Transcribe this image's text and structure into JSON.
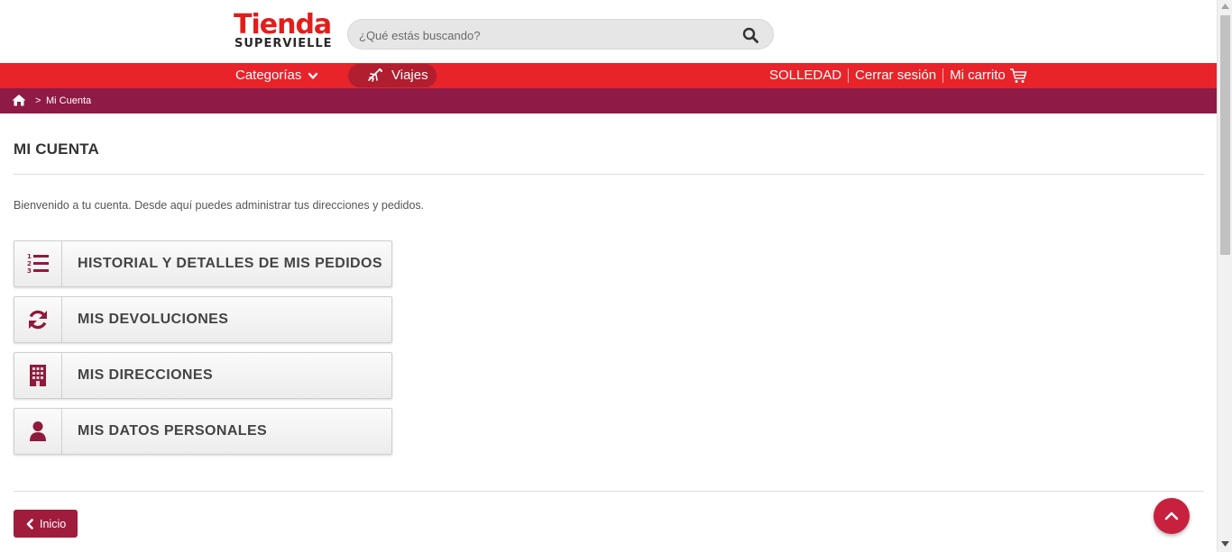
{
  "brand": {
    "name": "Tienda",
    "sub": "SUPERVIELLE",
    "color": "#e31d1a"
  },
  "search": {
    "placeholder": "¿Qué estás buscando?",
    "value": "",
    "icon": "search-icon"
  },
  "nav": {
    "categories_label": "Categorías",
    "viajes_label": "Viajes",
    "user_label": "SOLLEDAD",
    "logout_label": "Cerrar sesión",
    "cart_label": "Mi carrito",
    "bar_color": "#e8232a"
  },
  "breadcrumb": {
    "separator": ">",
    "current": "Mi Cuenta",
    "bar_color": "#8e1a45"
  },
  "main": {
    "title": "MI CUENTA",
    "welcome": "Bienvenido a tu cuenta. Desde aquí puedes administrar tus direcciones y pedidos.",
    "options": [
      {
        "label": "HISTORIAL Y DETALLES DE MIS PEDIDOS",
        "icon": "ordered-list-icon"
      },
      {
        "label": "MIS DEVOLUCIONES",
        "icon": "refresh-icon"
      },
      {
        "label": "MIS DIRECCIONES",
        "icon": "building-icon"
      },
      {
        "label": "MIS DATOS PERSONALES",
        "icon": "user-icon"
      }
    ],
    "home_button": "Inicio",
    "accent_color": "#8e1a3c"
  }
}
